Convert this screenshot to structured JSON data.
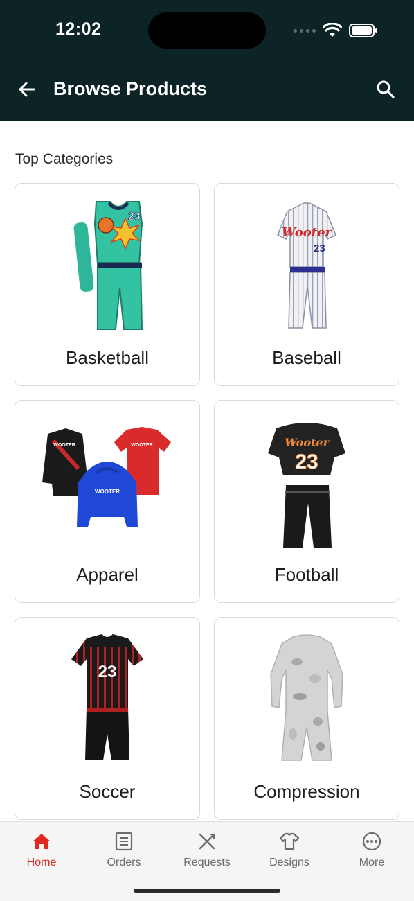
{
  "status_bar": {
    "time": "12:02"
  },
  "header": {
    "title": "Browse Products"
  },
  "section": {
    "title": "Top Categories"
  },
  "categories": [
    {
      "label": "Basketball",
      "jersey_number": "23"
    },
    {
      "label": "Baseball",
      "jersey_number": "23",
      "script": "Wooter"
    },
    {
      "label": "Apparel",
      "brand": "WOOTER"
    },
    {
      "label": "Football",
      "jersey_number": "23",
      "script": "Wooter"
    },
    {
      "label": "Soccer",
      "jersey_number": "23"
    },
    {
      "label": "Compression"
    }
  ],
  "bottom_nav": {
    "items": [
      {
        "label": "Home",
        "icon": "home-icon",
        "active": true
      },
      {
        "label": "Orders",
        "icon": "orders-icon",
        "active": false
      },
      {
        "label": "Requests",
        "icon": "requests-icon",
        "active": false
      },
      {
        "label": "Designs",
        "icon": "designs-icon",
        "active": false
      },
      {
        "label": "More",
        "icon": "more-icon",
        "active": false
      }
    ]
  },
  "colors": {
    "header_bg": "#0d2426",
    "accent": "#e0281c",
    "nav_inactive": "#6b6b6b"
  }
}
